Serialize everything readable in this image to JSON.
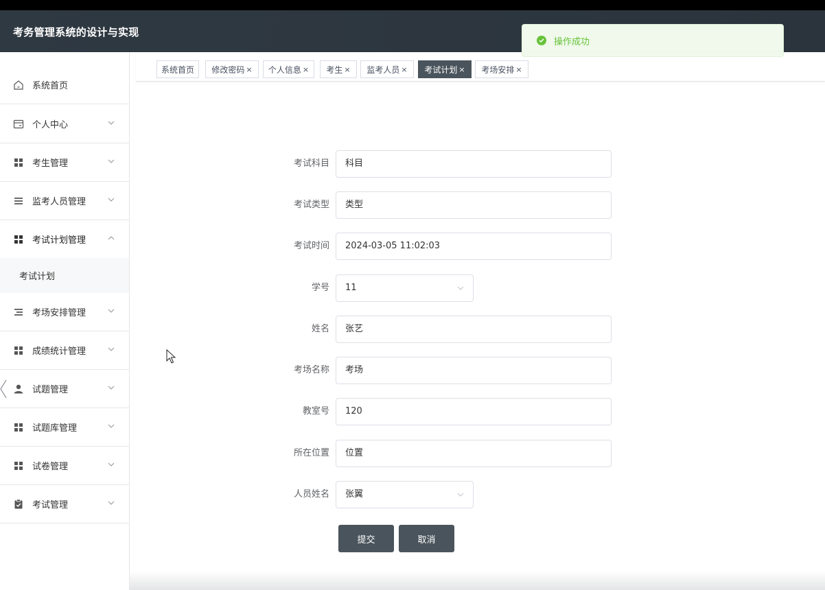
{
  "app": {
    "title": "考务管理系统的设计与实现"
  },
  "toast": {
    "message": "操作成功"
  },
  "sidebar": {
    "items": [
      {
        "label": "系统首页",
        "icon": "home-icon"
      },
      {
        "label": "个人中心",
        "icon": "card-icon"
      },
      {
        "label": "考生管理",
        "icon": "grid-icon"
      },
      {
        "label": "监考人员管理",
        "icon": "list-icon"
      },
      {
        "label": "考试计划管理",
        "icon": "grid-icon",
        "expanded": true
      },
      {
        "label": "考场安排管理",
        "icon": "list-icon"
      },
      {
        "label": "成绩统计管理",
        "icon": "grid-icon"
      },
      {
        "label": "试题管理",
        "icon": "user-icon"
      },
      {
        "label": "试题库管理",
        "icon": "grid-icon"
      },
      {
        "label": "试卷管理",
        "icon": "grid-icon"
      },
      {
        "label": "考试管理",
        "icon": "clipboard-check-icon"
      }
    ],
    "submenu": {
      "label": "考试计划"
    }
  },
  "tabs": [
    {
      "label": "系统首页",
      "closable": false
    },
    {
      "label": "修改密码",
      "closable": true
    },
    {
      "label": "个人信息",
      "closable": true
    },
    {
      "label": "考生",
      "closable": true
    },
    {
      "label": "监考人员",
      "closable": true
    },
    {
      "label": "考试计划",
      "closable": true,
      "active": true
    },
    {
      "label": "考场安排",
      "closable": true
    }
  ],
  "tab_close_glyph": "×",
  "form": {
    "fields": [
      {
        "label": "考试科目",
        "value": "科目",
        "type": "text"
      },
      {
        "label": "考试类型",
        "value": "类型",
        "type": "text"
      },
      {
        "label": "考试时间",
        "value": "2024-03-05 11:02:03",
        "type": "datetime"
      },
      {
        "label": "学号",
        "value": "11",
        "type": "select"
      },
      {
        "label": "姓名",
        "value": "张艺",
        "type": "text"
      },
      {
        "label": "考场名称",
        "value": "考场",
        "type": "text"
      },
      {
        "label": "教室号",
        "value": "120",
        "type": "text"
      },
      {
        "label": "所在位置",
        "value": "位置",
        "type": "text"
      },
      {
        "label": "人员姓名",
        "value": "张翼",
        "type": "select"
      }
    ],
    "submit_label": "提交",
    "cancel_label": "取消"
  },
  "colors": {
    "header_bg": "#2f3942",
    "accent_dark": "#4a545c",
    "success": "#67c23a",
    "toast_bg": "#f0f9eb"
  }
}
